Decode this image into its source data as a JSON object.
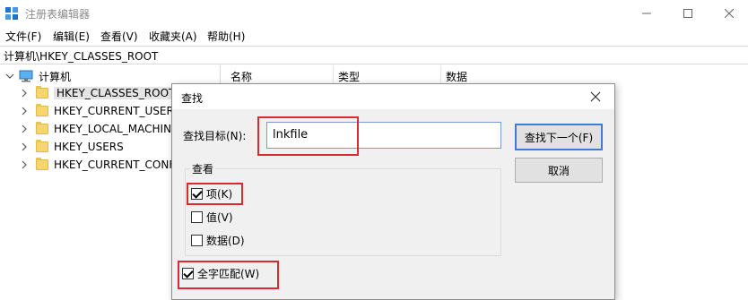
{
  "window": {
    "title": "注册表编辑器"
  },
  "menu": [
    "文件(F)",
    "编辑(E)",
    "查看(V)",
    "收藏夹(A)",
    "帮助(H)"
  ],
  "address": "计算机\\HKEY_CLASSES_ROOT",
  "tree": {
    "root": "计算机",
    "items": [
      {
        "label": "HKEY_CLASSES_ROOT",
        "selected": true
      },
      {
        "label": "HKEY_CURRENT_USER"
      },
      {
        "label": "HKEY_LOCAL_MACHINE"
      },
      {
        "label": "HKEY_USERS"
      },
      {
        "label": "HKEY_CURRENT_CONFIG"
      }
    ]
  },
  "columns": [
    "名称",
    "类型",
    "数据"
  ],
  "dialog": {
    "title": "查找",
    "find_label": "查找目标(N):",
    "find_value": "lnkfile",
    "find_next": "查找下一个(F)",
    "cancel": "取消",
    "group_title": "查看",
    "opt_keys": "项(K)",
    "opt_keys_checked": true,
    "opt_values": "值(V)",
    "opt_values_checked": false,
    "opt_data": "数据(D)",
    "opt_data_checked": false,
    "whole_match": "全字匹配(W)",
    "whole_match_checked": true
  },
  "colors": {
    "highlight": "#d92b2b",
    "focus_border": "#3c7fd1",
    "folder": "#f5d66e"
  }
}
